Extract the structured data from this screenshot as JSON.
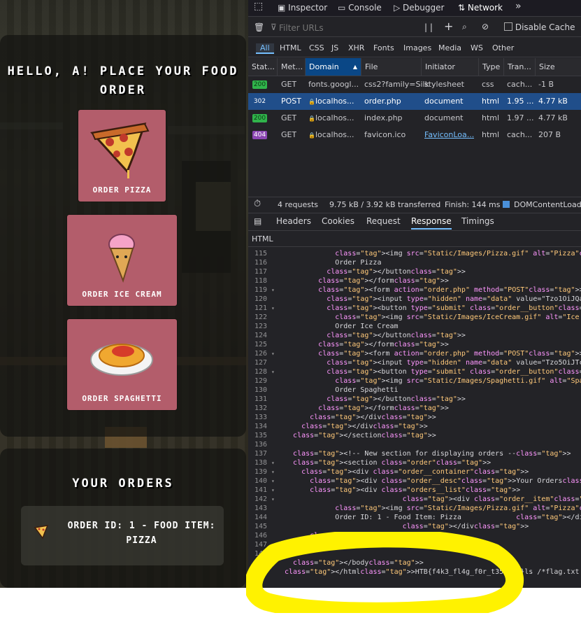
{
  "game": {
    "greeting": "HELLO, A! PLACE YOUR FOOD ORDER",
    "menu": [
      {
        "label": "ORDER PIZZA",
        "icon": "pizza-icon"
      },
      {
        "label": "ORDER ICE CREAM",
        "icon": "ice-cream-icon"
      },
      {
        "label": "ORDER SPAGHETTI",
        "icon": "spaghetti-icon"
      }
    ],
    "orders_title": "YOUR ORDERS",
    "order_item": {
      "text": "ORDER ID: 1 - FOOD ITEM: PIZZA",
      "icon": "pizza-icon"
    },
    "colors": {
      "card": "#b35d6b",
      "panel": "#141410"
    }
  },
  "devtools": {
    "toolbar": {
      "inspector": "Inspector",
      "console": "Console",
      "debugger": "Debugger",
      "network": "Network",
      "more": "»"
    },
    "filter": {
      "placeholder": "Filter URLs",
      "pause": "| |",
      "disable_cache": "Disable Cache"
    },
    "types": [
      "All",
      "HTML",
      "CSS",
      "JS",
      "XHR",
      "Fonts",
      "Images",
      "Media",
      "WS",
      "Other"
    ],
    "columns": [
      "Stat...",
      "Met...",
      "Domain",
      "File",
      "Initiator",
      "Type",
      "Tran...",
      "Size"
    ],
    "requests": [
      {
        "status": "200",
        "method": "GET",
        "domain": "fonts.googl...",
        "file": "css2?family=Silk",
        "initiator": "stylesheet",
        "type": "css",
        "transferred": "cach...",
        "size": "-1 B"
      },
      {
        "status": "302",
        "method": "POST",
        "domain": "localhos...",
        "file": "order.php",
        "initiator": "document",
        "type": "html",
        "transferred": "1.95 ...",
        "size": "4.77 kB"
      },
      {
        "status": "200",
        "method": "GET",
        "domain": "localhos...",
        "file": "index.php",
        "initiator": "document",
        "type": "html",
        "transferred": "1.97 ...",
        "size": "4.77 kB"
      },
      {
        "status": "404",
        "method": "GET",
        "domain": "localhos...",
        "file": "favicon.ico",
        "initiator": "FaviconLoa...",
        "type": "html",
        "transferred": "cach...",
        "size": "207 B"
      }
    ],
    "summary": {
      "requests": "4 requests",
      "transferred": "9.75 kB / 3.92 kB transferred",
      "finish": "Finish: 144 ms",
      "domcontent": "DOMContentLoad"
    },
    "detail_tabs": [
      "Headers",
      "Cookies",
      "Request",
      "Response",
      "Timings"
    ],
    "response_label": "HTML",
    "code": [
      {
        "n": "115",
        "t": "",
        "s": "            <img src=\"Static/Images/Pizza.gif\" alt=\"Pizza\">"
      },
      {
        "n": "116",
        "t": "",
        "s": "            Order Pizza"
      },
      {
        "n": "117",
        "t": "",
        "s": "          </button>"
      },
      {
        "n": "118",
        "t": "",
        "s": "        </form>"
      },
      {
        "n": "119",
        "t": "▾",
        "s": "        <form action=\"order.php\" method=\"POST\">"
      },
      {
        "n": "120",
        "t": "",
        "s": "          <input type=\"hidden\" name=\"data\" value=\"Tzo1OiJQaXp6YSI6M"
      },
      {
        "n": "121",
        "t": "▾",
        "s": "          <button type=\"submit\" class=\"order__button\">"
      },
      {
        "n": "122",
        "t": "",
        "s": "            <img src=\"Static/Images/IceCream.gif\" alt=\"Ice Cream\">"
      },
      {
        "n": "123",
        "t": "",
        "s": "            Order Ice Cream"
      },
      {
        "n": "124",
        "t": "",
        "s": "          </button>"
      },
      {
        "n": "125",
        "t": "",
        "s": "        </form>"
      },
      {
        "n": "126",
        "t": "▾",
        "s": "        <form action=\"order.php\" method=\"POST\">"
      },
      {
        "n": "127",
        "t": "",
        "s": "          <input type=\"hidden\" name=\"data\" value=\"Tzo5OiJTcGFnaGV0d"
      },
      {
        "n": "128",
        "t": "▾",
        "s": "          <button type=\"submit\" class=\"order__button\">"
      },
      {
        "n": "129",
        "t": "",
        "s": "            <img src=\"Static/Images/Spaghetti.gif\" alt=\"Spaghetti\">"
      },
      {
        "n": "130",
        "t": "",
        "s": "            Order Spaghetti"
      },
      {
        "n": "131",
        "t": "",
        "s": "          </button>"
      },
      {
        "n": "132",
        "t": "",
        "s": "        </form>"
      },
      {
        "n": "133",
        "t": "",
        "s": "      </div>"
      },
      {
        "n": "134",
        "t": "",
        "s": "    </div>"
      },
      {
        "n": "135",
        "t": "",
        "s": "  </section>"
      },
      {
        "n": "136",
        "t": "",
        "s": ""
      },
      {
        "n": "137",
        "t": "",
        "s": "  <!-- New section for displaying orders -->"
      },
      {
        "n": "138",
        "t": "▾",
        "s": "  <section class=\"order\">"
      },
      {
        "n": "139",
        "t": "▾",
        "s": "    <div class=\"order__container\">"
      },
      {
        "n": "140",
        "t": "▾",
        "s": "      <div class=\"order__desc\">Your Orders</div>"
      },
      {
        "n": "141",
        "t": "▾",
        "s": "      <div class=\"orders__list\">"
      },
      {
        "n": "142",
        "t": "▾",
        "s": "                            <div class=\"order__item\">"
      },
      {
        "n": "143",
        "t": "",
        "s": "            <img src=\"Static/Images/Pizza.gif\" alt=\"Pizza\">"
      },
      {
        "n": "144",
        "t": "",
        "s": "            Order ID: 1 - Food Item: Pizza             </div>"
      },
      {
        "n": "145",
        "t": "",
        "s": "                            </div>"
      },
      {
        "n": "146",
        "t": "",
        "s": "      </div>"
      },
      {
        "n": "147",
        "t": "",
        "s": ""
      },
      {
        "n": "148",
        "t": "",
        "s": ""
      },
      {
        "n": "",
        "t": "",
        "s": "  </body>"
      },
      {
        "n": "",
        "t": "",
        "s": "</html>HTB{f4k3_fl4g_f0r_t35t1ng}ls /*flag.txt | ...ent"
      }
    ],
    "highlight_color": "#fff200"
  }
}
